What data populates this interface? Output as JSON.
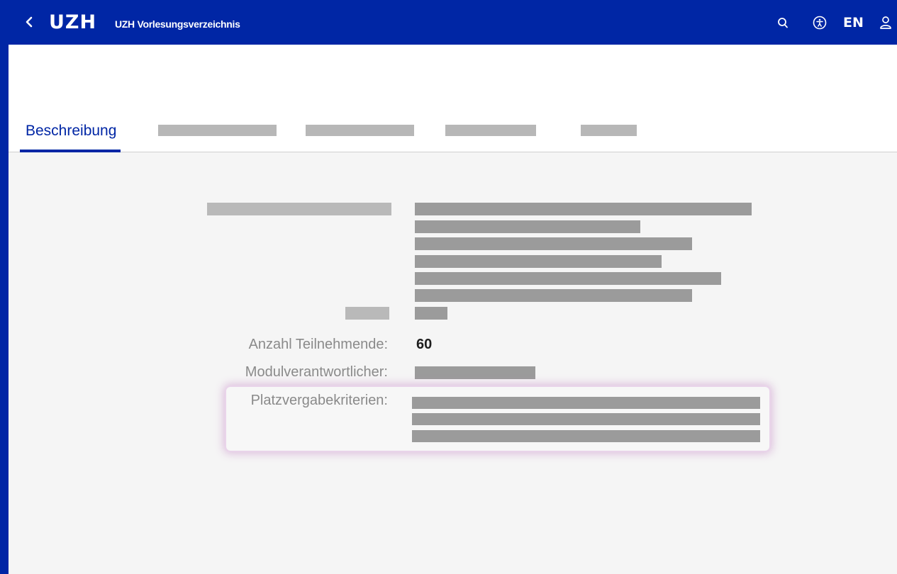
{
  "header": {
    "back_glyph": "‹",
    "logo": "UZH",
    "app_title": "UZH Vorlesungsverzeichnis",
    "language": "EN",
    "icons": [
      "search-icon",
      "accessibility-icon",
      "user-icon"
    ]
  },
  "tabs": [
    {
      "label": "Beschreibung",
      "active": true
    },
    {
      "label": "",
      "redacted": true
    },
    {
      "label": "",
      "redacted": true
    },
    {
      "label": "",
      "redacted": true
    },
    {
      "label": "",
      "redacted": true
    }
  ],
  "details": {
    "participants_label": "Anzahl Teilnehmende:",
    "participants_value": "60",
    "module_lead_label": "Modulverantwortlicher:",
    "allocation_label": "Platzvergabekriterien:"
  },
  "colors": {
    "brand_blue": "#0026a5",
    "redaction_gray": "#9b9b9b",
    "highlight_glow": "#c87ec8"
  }
}
